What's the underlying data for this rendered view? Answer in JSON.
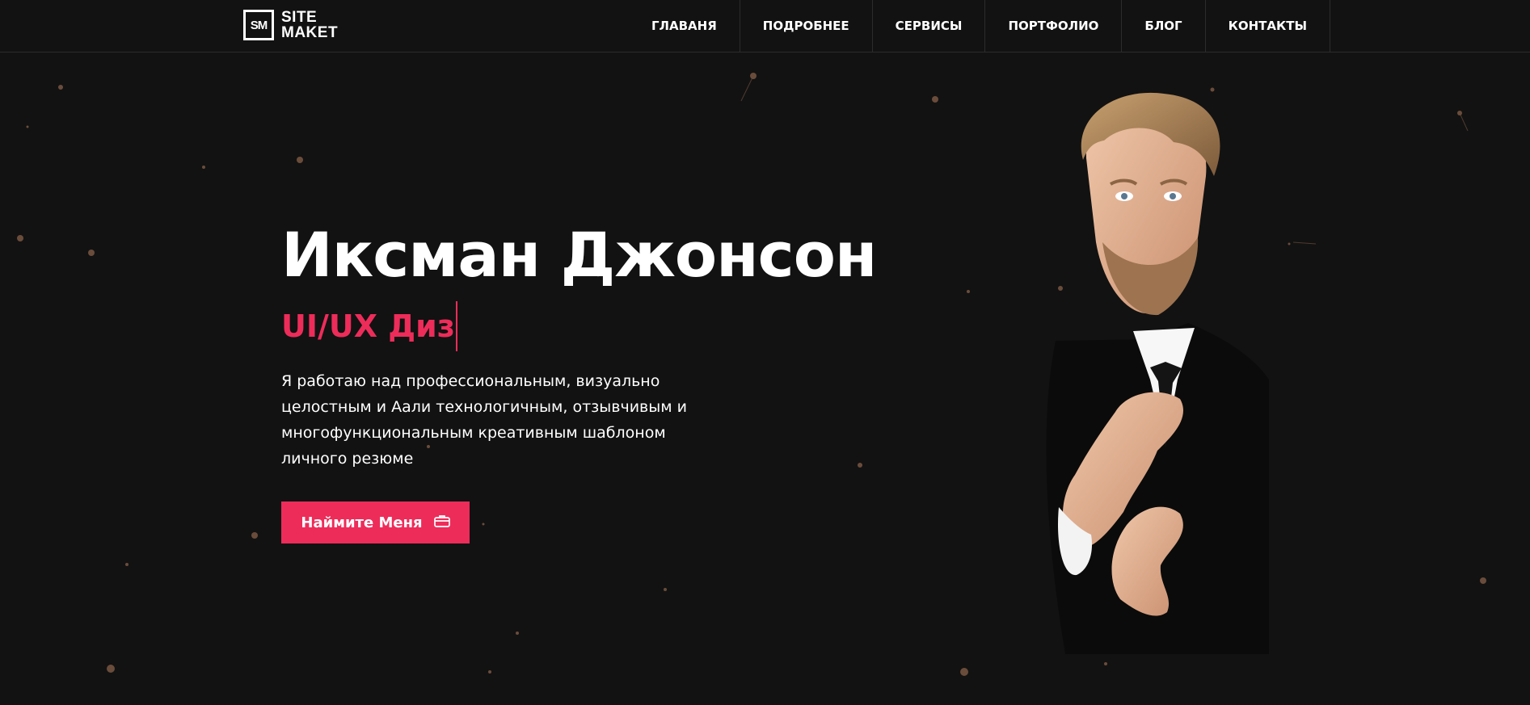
{
  "brand": {
    "logo_mark": "SM",
    "logo_line1": "SITE",
    "logo_line2": "MAKET"
  },
  "nav": {
    "items": [
      "ГЛАВАНЯ",
      "ПОДРОБНЕЕ",
      "СЕРВИСЫ",
      "ПОРТФОЛИО",
      "БЛОГ",
      "КОНТАКТЫ"
    ]
  },
  "hero": {
    "name": "Иксман Джонсон",
    "role_typed": "UI/UX Диз",
    "bio": "Я работаю над профессиональным, визуально целостным и Аали технологичным, отзывчивым и многофункциональным креативным шаблоном личного резюме",
    "cta_label": "Наймите Меня",
    "cta_icon": "briefcase-icon"
  },
  "colors": {
    "background": "#121212",
    "accent": "#ed2c5a",
    "text": "#ffffff",
    "divider": "#2c2c2c",
    "particle": "#6a4c3b"
  }
}
